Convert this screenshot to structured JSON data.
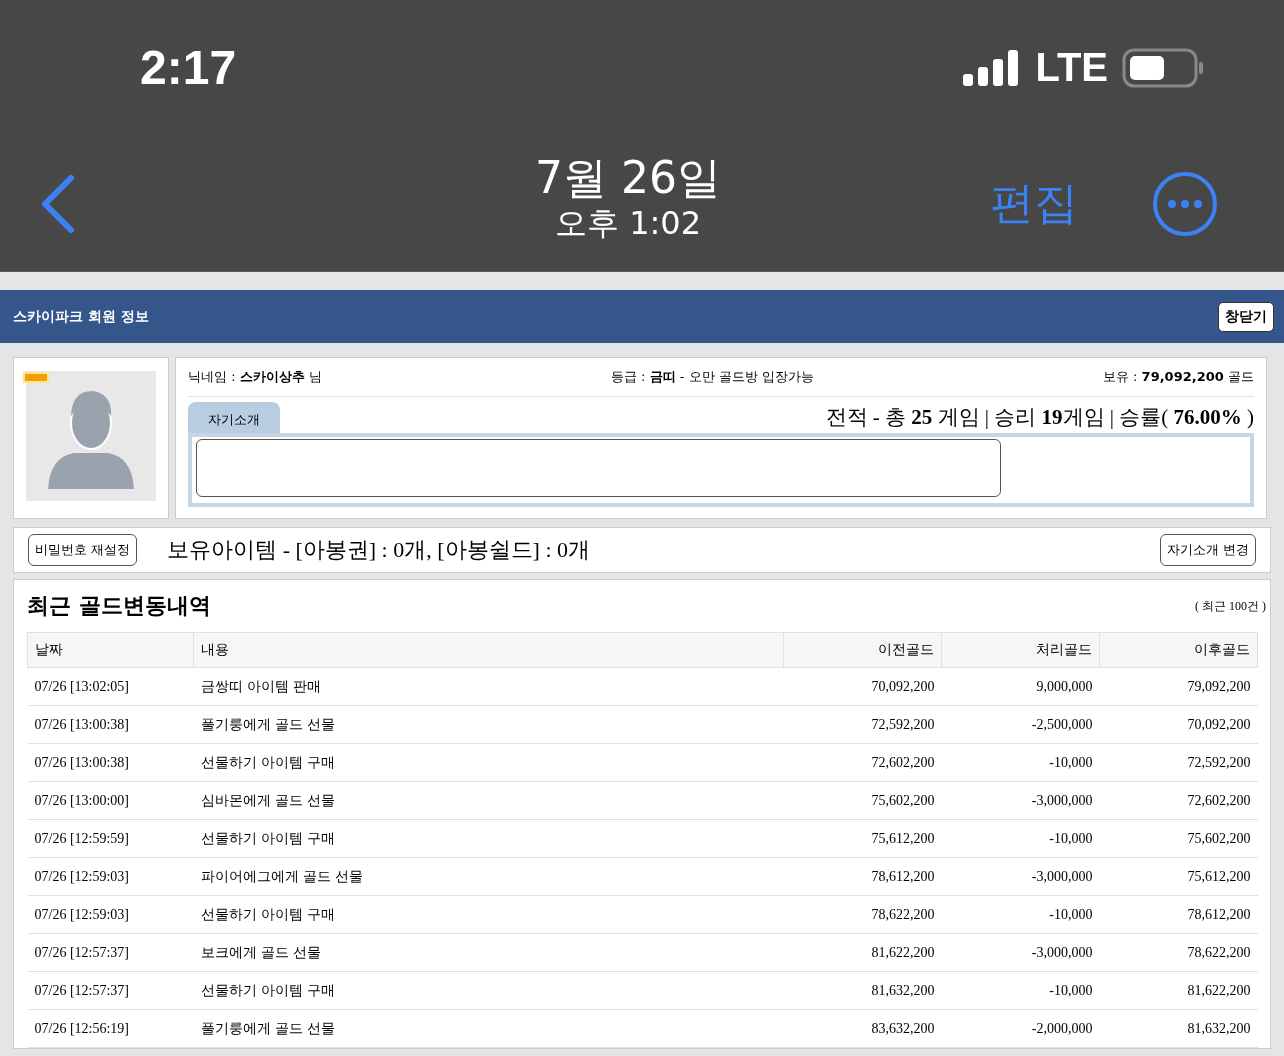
{
  "status_bar": {
    "time": "2:17",
    "network": "LTE"
  },
  "nav_bar": {
    "date": "7월 26일",
    "time": "오후 1:02",
    "edit_button": "편집"
  },
  "window": {
    "title": "스카이파크 회원 정보",
    "close_button": "창닫기"
  },
  "profile": {
    "nickname": "닉네임 : **스카이상추** 님",
    "grade": "등급 : **금띠** - 오만 골드방 입장가능",
    "holding": "보유 : **79,092,200** 골드",
    "tab": "자기소개",
    "record": "전적 - 총 **25** 게임 | 승리 **19**게임 | 승률( **76.00%** )"
  },
  "items_bar": {
    "reset_password_button": "비밀번호 재설정",
    "items": "보유아이템 - [아봉권] : 0개, [아봉쉴드] : 0개",
    "edit_intro_button": "자기소개 변경"
  },
  "history": {
    "title": "최근 골드변동내역",
    "count": "( 최근 100건 )",
    "table": {
      "columns": [
        "날짜",
        "내용",
        "이전골드",
        "처리골드",
        "이후골드"
      ],
      "rows": [
        [
          "07/26 [13:02:05]",
          "금쌍띠 아이템 판매",
          "70,092,200",
          "9,000,000",
          "79,092,200"
        ],
        [
          "07/26 [13:00:38]",
          "풀기룽에게 골드 선물",
          "72,592,200",
          "-2,500,000",
          "70,092,200"
        ],
        [
          "07/26 [13:00:38]",
          "선물하기 아이템 구매",
          "72,602,200",
          "-10,000",
          "72,592,200"
        ],
        [
          "07/26 [13:00:00]",
          "심바몬에게 골드 선물",
          "75,602,200",
          "-3,000,000",
          "72,602,200"
        ],
        [
          "07/26 [12:59:59]",
          "선물하기 아이템 구매",
          "75,612,200",
          "-10,000",
          "75,602,200"
        ],
        [
          "07/26 [12:59:03]",
          "파이어에그에게 골드 선물",
          "78,612,200",
          "-3,000,000",
          "75,612,200"
        ],
        [
          "07/26 [12:59:03]",
          "선물하기 아이템 구매",
          "78,622,200",
          "-10,000",
          "78,612,200"
        ],
        [
          "07/26 [12:57:37]",
          "보크에게 골드 선물",
          "81,622,200",
          "-3,000,000",
          "78,622,200"
        ],
        [
          "07/26 [12:57:37]",
          "선물하기 아이템 구매",
          "81,632,200",
          "-10,000",
          "81,622,200"
        ],
        [
          "07/26 [12:56:19]",
          "풀기룽에게 골드 선물",
          "83,632,200",
          "-2,000,000",
          "81,632,200"
        ]
      ]
    }
  }
}
